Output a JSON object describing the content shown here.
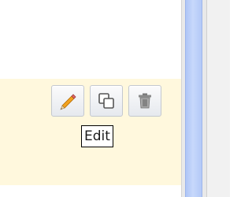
{
  "toolbar": {
    "buttons": [
      {
        "name": "edit",
        "icon": "pencil-icon"
      },
      {
        "name": "copy",
        "icon": "copy-icon"
      },
      {
        "name": "delete",
        "icon": "trash-icon"
      }
    ],
    "tooltip": "Edit"
  },
  "colors": {
    "row_highlight": "#fff8dd",
    "scrollbar_thumb": "#c7d8fb",
    "scrollbar_track": "#e9e9e9"
  }
}
